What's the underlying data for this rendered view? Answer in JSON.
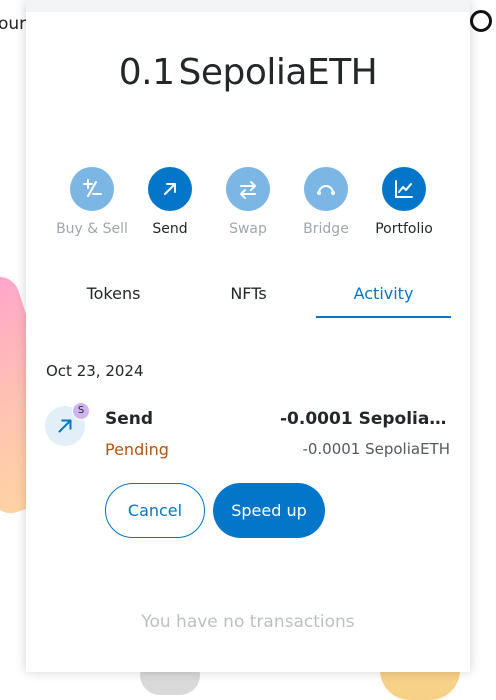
{
  "background": {
    "partial_text": "our"
  },
  "wallet": {
    "balance_amount": "0.1",
    "balance_unit": "SepoliaETH"
  },
  "actions": [
    {
      "label": "Buy & Sell",
      "icon": "plus-minus-icon",
      "enabled": false
    },
    {
      "label": "Send",
      "icon": "arrow-up-right-icon",
      "enabled": true
    },
    {
      "label": "Swap",
      "icon": "swap-arrows-icon",
      "enabled": false
    },
    {
      "label": "Bridge",
      "icon": "bridge-icon",
      "enabled": false
    },
    {
      "label": "Portfolio",
      "icon": "chart-icon",
      "enabled": true
    }
  ],
  "tabs": [
    {
      "label": "Tokens",
      "active": false
    },
    {
      "label": "NFTs",
      "active": false
    },
    {
      "label": "Activity",
      "active": true
    }
  ],
  "activity": {
    "date": "Oct 23, 2024",
    "transaction": {
      "title": "Send",
      "status": "Pending",
      "amount": "-0.0001 SepoliaETH",
      "fiat": "-0.0001 SepoliaETH",
      "badge": "S"
    },
    "cancel_label": "Cancel",
    "speed_up_label": "Speed up",
    "empty_message": "You have no transactions"
  },
  "colors": {
    "primary": "#0376c9",
    "primary_disabled": "#7cb6e4",
    "pending": "#b6530f",
    "muted": "#bbc0c5"
  }
}
